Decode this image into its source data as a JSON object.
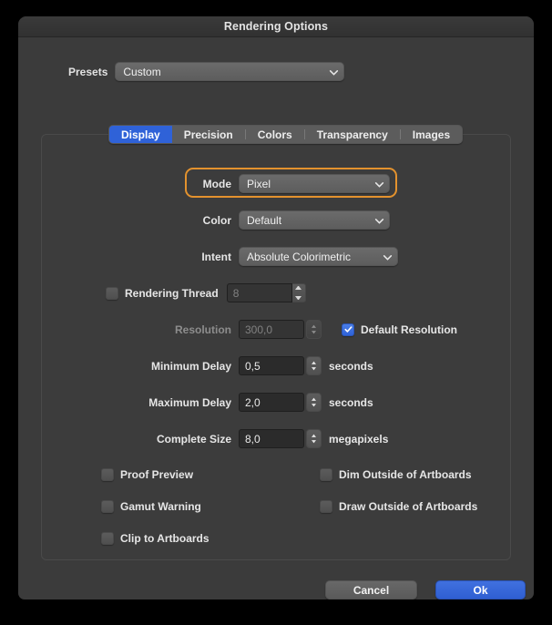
{
  "window": {
    "title": "Rendering Options"
  },
  "presets": {
    "label": "Presets",
    "value": "Custom",
    "chevron_icon": "chevron-down-icon"
  },
  "tabs": [
    {
      "label": "Display",
      "active": true
    },
    {
      "label": "Precision",
      "active": false
    },
    {
      "label": "Colors",
      "active": false
    },
    {
      "label": "Transparency",
      "active": false
    },
    {
      "label": "Images",
      "active": false
    }
  ],
  "display": {
    "mode": {
      "label": "Mode",
      "value": "Pixel",
      "focused": true
    },
    "color": {
      "label": "Color",
      "value": "Default"
    },
    "intent": {
      "label": "Intent",
      "value": "Absolute Colorimetric"
    },
    "rendering_thread": {
      "label": "Rendering Thread",
      "checked": false,
      "value": "8",
      "enabled": false
    },
    "resolution": {
      "label": "Resolution",
      "value": "300,0",
      "enabled": false
    },
    "default_resolution": {
      "label": "Default Resolution",
      "checked": true
    },
    "minimum_delay": {
      "label": "Minimum Delay",
      "value": "0,5",
      "unit": "seconds"
    },
    "maximum_delay": {
      "label": "Maximum Delay",
      "value": "2,0",
      "unit": "seconds"
    },
    "complete_size": {
      "label": "Complete Size",
      "value": "8,0",
      "unit": "megapixels"
    },
    "checkboxes_left": [
      {
        "label": "Proof Preview",
        "checked": false
      },
      {
        "label": "Gamut Warning",
        "checked": false
      },
      {
        "label": "Clip to Artboards",
        "checked": false
      }
    ],
    "checkboxes_right": [
      {
        "label": "Dim Outside of Artboards",
        "checked": false
      },
      {
        "label": "Draw Outside of Artboards",
        "checked": false
      }
    ]
  },
  "footer": {
    "cancel_label": "Cancel",
    "ok_label": "Ok"
  },
  "colors": {
    "accent_blue": "#2f62d8",
    "focus_orange": "#e3922e",
    "window_bg": "#3b3b3b",
    "panel_bg": "#3c3c3c",
    "text": "#e6e6e6",
    "text_dim": "#8d8d8d"
  }
}
